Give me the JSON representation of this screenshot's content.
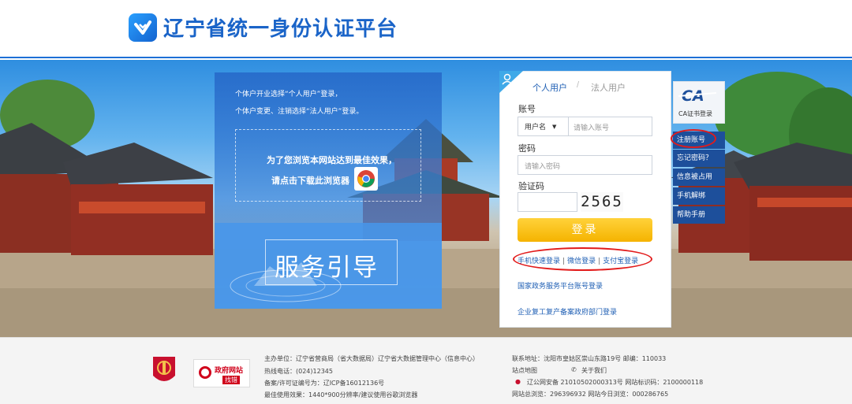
{
  "header": {
    "title": "辽宁省统一身份认证平台"
  },
  "guide": {
    "line1": "个体户开业选择“个人用户”登录，",
    "line2": "个体户变更、注销选择“法人用户”登录。",
    "browser_line1": "为了您浏览本网站达到最佳效果，",
    "browser_line2": "请点击下载此浏览器",
    "title": "服务引导"
  },
  "login": {
    "tab_personal": "个人用户",
    "tab_separator": "/",
    "tab_legal": "法人用户",
    "account_label": "账号",
    "account_type": "用户名",
    "account_placeholder": "请输入账号",
    "password_label": "密码",
    "password_placeholder": "请输入密码",
    "captcha_label": "验证码",
    "captcha_value": "2565",
    "login_button": "登录",
    "quick_links": [
      "手机快速登录",
      "微信登录",
      "支付宝登录"
    ],
    "link_separator": "|",
    "national_link": "国家政务服务平台账号登录",
    "enterprise_link": "企业复工复产备案政府部门登录"
  },
  "side_menu": {
    "ca_label": "CA证书登录",
    "items": [
      "注册账号",
      "忘记密码？",
      "信息被占用",
      "手机解绑",
      "帮助手册"
    ]
  },
  "footer": {
    "sponsor": "主办单位：辽宁省营商局（省大数据局）辽宁省大数据管理中心（信息中心）",
    "hotline": "热线电话：(024)12345",
    "icp": "备案/许可证编号为：辽ICP备16012136号",
    "best_view": "最佳使用效果：1440*900分辨率/建议使用谷歌浏览器",
    "address": "联系地址：沈阳市皇姑区崇山东路19号    邮编：110033",
    "site_map": "站点地图",
    "about_us": "关于我们",
    "police_record": "辽公网安备 21010502000313号  网站标识码：2100000118",
    "total_visits": "网站总浏览：296396932     网站今日浏览：000286765",
    "gov_badge_line1": "政府网站",
    "gov_badge_line2": "找错"
  },
  "colors": {
    "brand_blue": "#1a64c8",
    "login_yellow": "#f5b300",
    "side_menu": "#1d4f9b",
    "highlight_red": "#e21b1b"
  }
}
